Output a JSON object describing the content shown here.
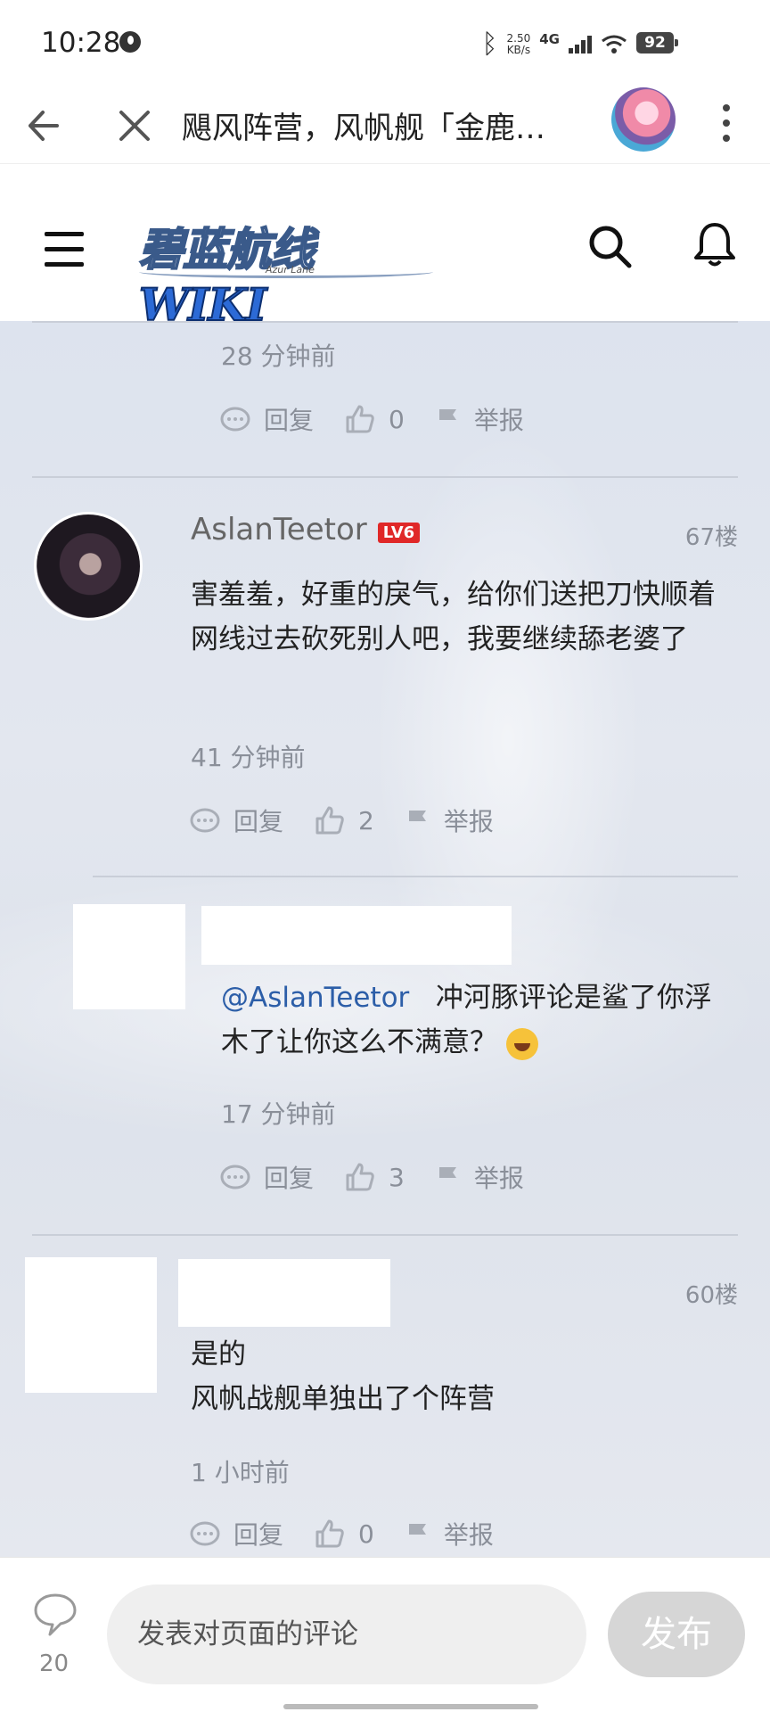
{
  "status_bar": {
    "time": "10:28",
    "speed": "2.50",
    "speed_unit": "KB/s",
    "network": "4G",
    "battery": "92"
  },
  "browser": {
    "title": "飓风阵营，风帆舰「金鹿…"
  },
  "wiki": {
    "logo_text": "碧蓝航线",
    "logo_wiki": "WIKI",
    "logo_sub": "Azur Lane"
  },
  "comments": [
    {
      "time": "28 分钟前",
      "reply_label": "回复",
      "likes": "0",
      "report_label": "举报"
    },
    {
      "username": "AslanTeetor",
      "level": "LV6",
      "floor": "67楼",
      "body": "害羞羞，好重的戾气，给你们送把刀快顺着网线过去砍死别人吧，我要继续舔老婆了",
      "time": "41 分钟前",
      "reply_label": "回复",
      "likes": "2",
      "report_label": "举报"
    },
    {
      "mention": "@AslanTeetor",
      "body": "冲河豚评论是鲨了你浮木了让你这么不满意？",
      "time": "17 分钟前",
      "reply_label": "回复",
      "likes": "3",
      "report_label": "举报"
    },
    {
      "floor": "60楼",
      "body_line1": "是的",
      "body_line2": "风帆战舰单独出了个阵营",
      "time": "1 小时前",
      "reply_label": "回复",
      "likes": "0",
      "report_label": "举报"
    }
  ],
  "footer": {
    "comment_count": "20",
    "input_placeholder": "发表对页面的评论",
    "publish_label": "发布"
  }
}
